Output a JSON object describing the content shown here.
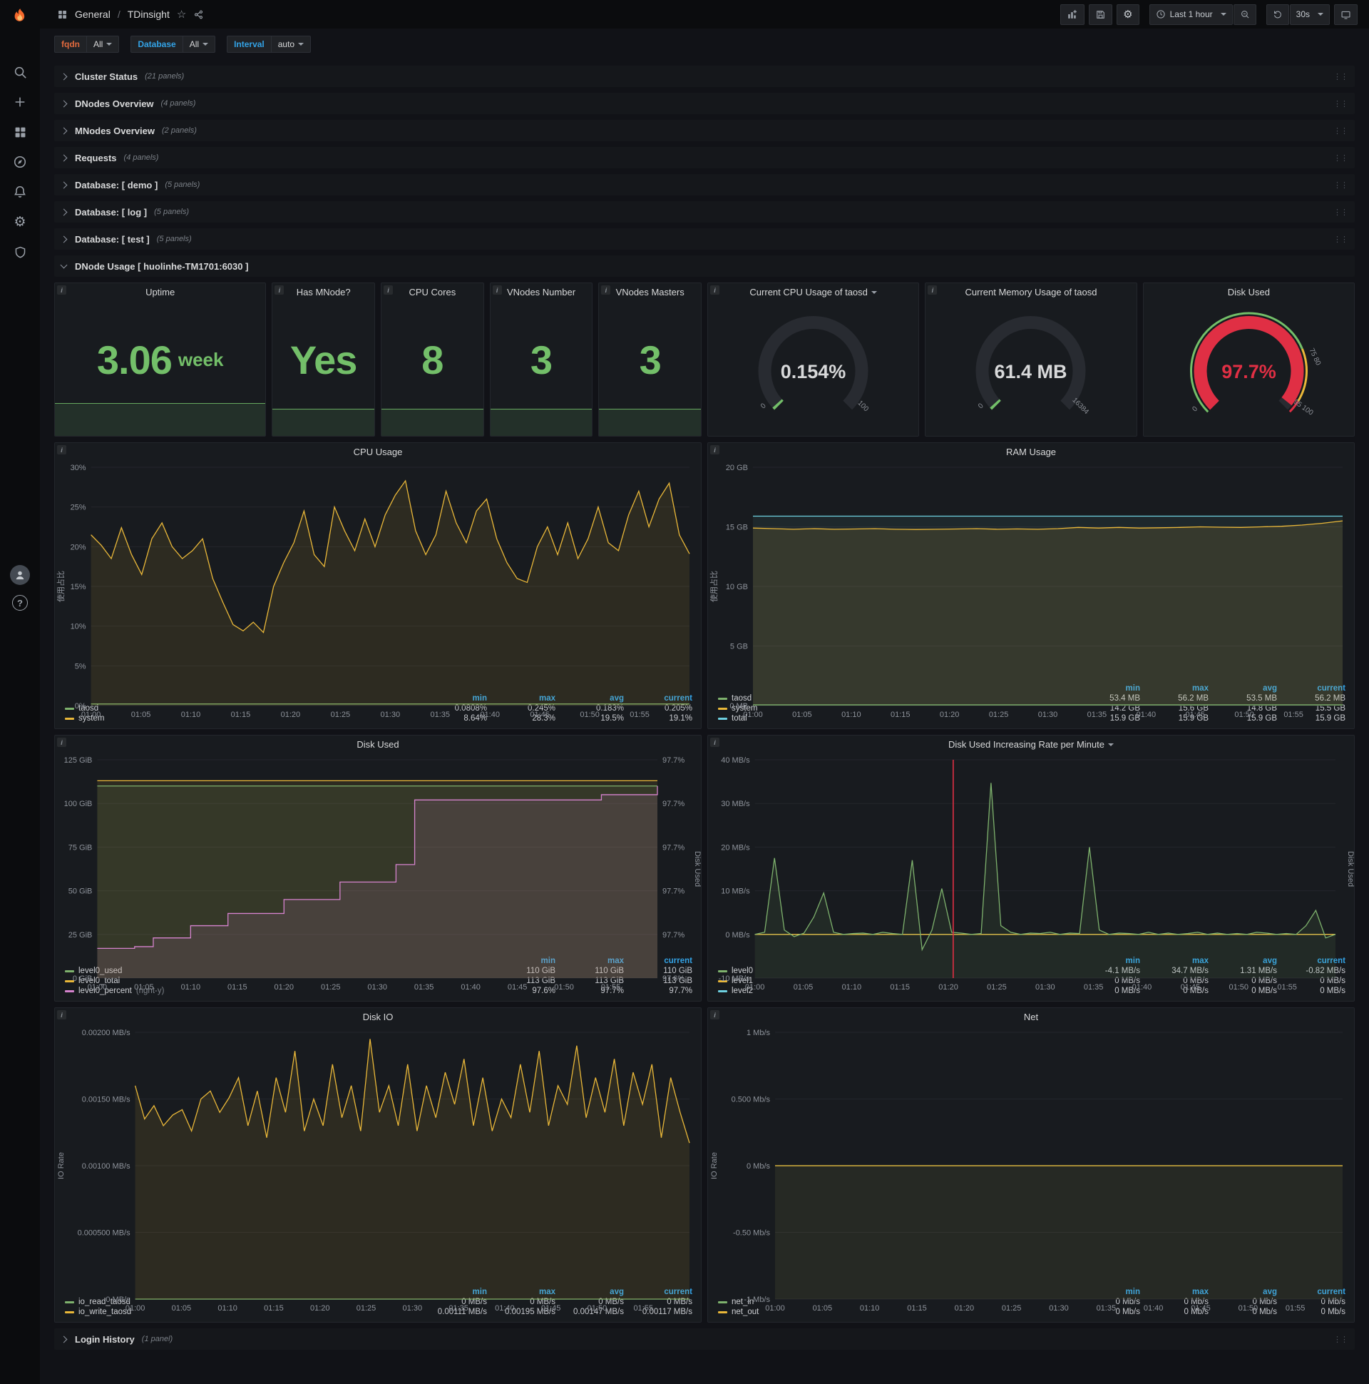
{
  "nav": {
    "breadcrumb": {
      "section": "General",
      "separator": "/",
      "title": "TDinsight"
    },
    "time_picker": {
      "label": "Last 1 hour"
    },
    "refresh": {
      "interval": "30s"
    }
  },
  "variables": [
    {
      "name": "fqdn",
      "label": "fqdn",
      "value": "All",
      "label_color": "#e0693d"
    },
    {
      "name": "database",
      "label": "Database",
      "value": "All",
      "label_color": "#33a2e5"
    },
    {
      "name": "interval",
      "label": "Interval",
      "value": "auto",
      "label_color": "#33a2e5"
    }
  ],
  "rows_top": [
    {
      "title": "Cluster Status",
      "count": "(21 panels)"
    },
    {
      "title": "DNodes Overview",
      "count": "(4 panels)"
    },
    {
      "title": "MNodes Overview",
      "count": "(2 panels)"
    },
    {
      "title": "Requests",
      "count": "(4 panels)"
    },
    {
      "title": "Database: [ demo ]",
      "count": "(5 panels)"
    },
    {
      "title": "Database: [ log ]",
      "count": "(5 panels)"
    },
    {
      "title": "Database: [ test ]",
      "count": "(5 panels)"
    }
  ],
  "expanded_row": {
    "title": "DNode Usage [ huolinhe-TM1701:6030 ]"
  },
  "rows_bottom": [
    {
      "title": "Login History",
      "count": "(1 panel)"
    }
  ],
  "stats": [
    {
      "title": "Uptime",
      "value": "3.06",
      "unit": "week",
      "color": "#73bf69"
    },
    {
      "title": "Has MNode?",
      "value": "Yes",
      "color": "#73bf69"
    },
    {
      "title": "CPU Cores",
      "value": "8",
      "color": "#73bf69"
    },
    {
      "title": "VNodes Number",
      "value": "3",
      "color": "#73bf69"
    },
    {
      "title": "VNodes Masters",
      "value": "3",
      "color": "#73bf69"
    }
  ],
  "gauges": [
    {
      "title": "Current CPU Usage of taosd",
      "menu_caret": true,
      "value": "0.154%",
      "min_label": "0",
      "max_label": "100",
      "fraction": 0.0015,
      "arc_color": "#73bf69",
      "value_color": "#d8d9da",
      "threshold_ring": false
    },
    {
      "title": "Current Memory Usage of taosd",
      "menu_caret": false,
      "value": "61.4 MB",
      "min_label": "0",
      "max_label": "16384",
      "fraction": 0.0037,
      "arc_color": "#73bf69",
      "value_color": "#d8d9da",
      "threshold_ring": false
    },
    {
      "title": "Disk Used",
      "menu_caret": false,
      "value": "97.7%",
      "min_label": "0",
      "max_label": "",
      "fraction": 0.977,
      "arc_color": "#e02f44",
      "value_color": "#e02f44",
      "threshold_ring": true,
      "ring_labels": [
        "75 80",
        "95 100"
      ]
    }
  ],
  "charts": {
    "time_axis": {
      "xlim": [
        0,
        60
      ],
      "ticks": [
        {
          "m": 0,
          "label": "01:00"
        },
        {
          "m": 5,
          "label": "01:05"
        },
        {
          "m": 10,
          "label": "01:10"
        },
        {
          "m": 15,
          "label": "01:15"
        },
        {
          "m": 20,
          "label": "01:20"
        },
        {
          "m": 25,
          "label": "01:25"
        },
        {
          "m": 30,
          "label": "01:30"
        },
        {
          "m": 35,
          "label": "01:35"
        },
        {
          "m": 40,
          "label": "01:40"
        },
        {
          "m": 45,
          "label": "01:45"
        },
        {
          "m": 50,
          "label": "01:50"
        },
        {
          "m": 55,
          "label": "01:55"
        }
      ]
    },
    "cpu": {
      "title": "CPU Usage",
      "chart_data": {
        "type": "line",
        "ylabel": "使用占比",
        "ylim": [
          0,
          30
        ],
        "y_ticks": [
          {
            "v": 0,
            "label": "0%"
          },
          {
            "v": 5,
            "label": "5%"
          },
          {
            "v": 10,
            "label": "10%"
          },
          {
            "v": 15,
            "label": "15%"
          },
          {
            "v": 20,
            "label": "20%"
          },
          {
            "v": 25,
            "label": "25%"
          },
          {
            "v": 30,
            "label": "30%"
          }
        ],
        "series": [
          {
            "name": "taosd",
            "color": "#7eb26d",
            "fill": 0.1,
            "values": [
              0.2
            ]
          },
          {
            "name": "system",
            "color": "#eab839",
            "fill": 0.1,
            "values": [
              21.5,
              20.2,
              18.5,
              22.4,
              19,
              16.5,
              21,
              23,
              20,
              18.5,
              19.5,
              21,
              16,
              13,
              10.2,
              9.4,
              10.5,
              9.2,
              15,
              18,
              20.5,
              24.5,
              19,
              17.5,
              25,
              22,
              19.5,
              23.5,
              20,
              24,
              26.5,
              28.3,
              22,
              19,
              21.5,
              27,
              23,
              20.5,
              24.5,
              26,
              21,
              18,
              16,
              15.5,
              20,
              22.5,
              19,
              23,
              18.5,
              21,
              25,
              20.5,
              19.5,
              24,
              27,
              22.5,
              26,
              28,
              21.5,
              19.1
            ]
          }
        ]
      },
      "legend": {
        "cols": [
          "min",
          "max",
          "avg",
          "current"
        ],
        "rows": [
          {
            "name": "taosd",
            "color": "#7eb26d",
            "values": [
              "0.0808%",
              "0.245%",
              "0.183%",
              "0.205%"
            ]
          },
          {
            "name": "system",
            "color": "#eab839",
            "values": [
              "8.64%",
              "28.3%",
              "19.5%",
              "19.1%"
            ]
          }
        ]
      }
    },
    "ram": {
      "title": "RAM Usage",
      "chart_data": {
        "type": "line",
        "ylabel": "使用占比",
        "ylim": [
          0,
          20
        ],
        "y_ticks": [
          {
            "v": 0,
            "label": "0 MB"
          },
          {
            "v": 5,
            "label": "5 GB"
          },
          {
            "v": 10,
            "label": "10 GB"
          },
          {
            "v": 15,
            "label": "15 GB"
          },
          {
            "v": 20,
            "label": "20 GB"
          }
        ],
        "series": [
          {
            "name": "total",
            "color": "#6ed0e0",
            "fill": 0.07,
            "values": [
              15.9
            ]
          },
          {
            "name": "system",
            "color": "#eab839",
            "fill": 0.12,
            "values": [
              14.9,
              14.85,
              14.8,
              14.85,
              14.8,
              14.82,
              14.85,
              14.8,
              14.78,
              14.8,
              14.82,
              14.85,
              14.8,
              14.83,
              14.8,
              14.85,
              14.95,
              14.9,
              14.95,
              14.9,
              14.92,
              14.95,
              15.0,
              14.97,
              14.95,
              15.0,
              15.05,
              15.15,
              15.3,
              15.5
            ]
          },
          {
            "name": "taosd",
            "color": "#7eb26d",
            "fill": 0.1,
            "values": [
              0.055
            ]
          }
        ]
      },
      "legend": {
        "cols": [
          "min",
          "max",
          "avg",
          "current"
        ],
        "rows": [
          {
            "name": "taosd",
            "color": "#7eb26d",
            "values": [
              "53.4 MB",
              "56.2 MB",
              "53.5 MB",
              "56.2 MB"
            ]
          },
          {
            "name": "system",
            "color": "#eab839",
            "values": [
              "14.2 GB",
              "15.6 GB",
              "14.8 GB",
              "15.5 GB"
            ]
          },
          {
            "name": "total",
            "color": "#6ed0e0",
            "values": [
              "15.9 GB",
              "15.9 GB",
              "15.9 GB",
              "15.9 GB"
            ]
          }
        ]
      }
    },
    "disk_used": {
      "title": "Disk Used",
      "chart_data": {
        "type": "line",
        "ylim": [
          0,
          125
        ],
        "y_ticks": [
          {
            "v": 0,
            "label": "0 GiB"
          },
          {
            "v": 25,
            "label": "25 GiB"
          },
          {
            "v": 50,
            "label": "50 GiB"
          },
          {
            "v": 75,
            "label": "75 GiB"
          },
          {
            "v": 100,
            "label": "100 GiB"
          },
          {
            "v": 125,
            "label": "125 GiB"
          }
        ],
        "right_label": "Disk Used",
        "right_ticks": {
          "labels": [
            "97.7%",
            "97.7%",
            "97.7%",
            "97.7%",
            "97.7%",
            "97.6%"
          ]
        },
        "rlim": [
          97.595,
          97.72
        ],
        "series": [
          {
            "name": "level0_total",
            "color": "#eab839",
            "fill": 0.1,
            "values": [
              113
            ]
          },
          {
            "name": "level0_used",
            "color": "#7eb26d",
            "fill": 0.1,
            "values": [
              110
            ]
          },
          {
            "name": "level0_percent",
            "color": "#d683ce",
            "fill": 0.12,
            "axis": "right",
            "step": true,
            "values": [
              97.612,
              97.612,
              97.613,
              97.618,
              97.618,
              97.625,
              97.625,
              97.632,
              97.632,
              97.632,
              97.64,
              97.64,
              97.64,
              97.65,
              97.65,
              97.65,
              97.66,
              97.697,
              97.697,
              97.697,
              97.697,
              97.697,
              97.697,
              97.697,
              97.697,
              97.697,
              97.697,
              97.7,
              97.7,
              97.7,
              97.705
            ]
          }
        ]
      },
      "legend": {
        "cols": [
          "min",
          "max",
          "current"
        ],
        "rows": [
          {
            "name": "level0_used",
            "color": "#7eb26d",
            "values": [
              "110 GiB",
              "110 GiB",
              "110 GiB"
            ]
          },
          {
            "name": "level0_total",
            "color": "#eab839",
            "values": [
              "113 GiB",
              "113 GiB",
              "113 GiB"
            ]
          },
          {
            "name": "level0_percent",
            "suffix": "(right-y)",
            "color": "#d683ce",
            "values": [
              "97.6%",
              "97.7%",
              "97.7%"
            ]
          }
        ]
      }
    },
    "disk_rate": {
      "title": "Disk Used Increasing Rate per Minute",
      "menu_caret": true,
      "chart_data": {
        "type": "line",
        "ylim": [
          -10,
          40
        ],
        "y_ticks": [
          {
            "v": -10,
            "label": "-10 MB/s"
          },
          {
            "v": 0,
            "label": "0 MB/s"
          },
          {
            "v": 10,
            "label": "10 MB/s"
          },
          {
            "v": 20,
            "label": "20 MB/s"
          },
          {
            "v": 30,
            "label": "30 MB/s"
          },
          {
            "v": 40,
            "label": "40 MB/s"
          }
        ],
        "right_label": "Disk Used",
        "annotation": {
          "x_minute": 20.5,
          "color": "#e02f44"
        },
        "series": [
          {
            "name": "level2",
            "color": "#6ed0e0",
            "fill": 0,
            "values": [
              0
            ]
          },
          {
            "name": "level1",
            "color": "#eab839",
            "fill": 0,
            "values": [
              0
            ]
          },
          {
            "name": "level0",
            "color": "#7eb26d",
            "fill": 0.1,
            "values": [
              0,
              0.5,
              17.5,
              1,
              -0.5,
              0.3,
              4,
              9.5,
              0.5,
              0,
              0.2,
              0.3,
              0,
              0.5,
              0.2,
              0,
              17,
              -3.5,
              1,
              10.5,
              0.5,
              0.3,
              0,
              0.2,
              34.7,
              2,
              0.5,
              0,
              0.3,
              0.2,
              0.5,
              0,
              0.3,
              0.2,
              20,
              1,
              0,
              0.3,
              0.2,
              0,
              0.5,
              0,
              0.3,
              0,
              0.2,
              0.5,
              0,
              0.3,
              0,
              0.2,
              0,
              0.5,
              0.3,
              0,
              0.2,
              0,
              2,
              5.5,
              -0.8,
              0
            ]
          }
        ]
      },
      "legend": {
        "cols": [
          "min",
          "max",
          "avg",
          "current"
        ],
        "rows": [
          {
            "name": "level0",
            "color": "#7eb26d",
            "values": [
              "-4.1 MB/s",
              "34.7 MB/s",
              "1.31 MB/s",
              "-0.82 MB/s"
            ]
          },
          {
            "name": "level1",
            "color": "#eab839",
            "values": [
              "0 MB/s",
              "0 MB/s",
              "0 MB/s",
              "0 MB/s"
            ]
          },
          {
            "name": "level2",
            "color": "#6ed0e0",
            "values": [
              "0 MB/s",
              "0 MB/s",
              "0 MB/s",
              "0 MB/s"
            ]
          }
        ]
      }
    },
    "disk_io": {
      "title": "Disk IO",
      "chart_data": {
        "type": "line",
        "ylabel": "IO Rate",
        "ylim": [
          0,
          0.002
        ],
        "y_ticks": [
          {
            "v": 0,
            "label": "0 MB/s"
          },
          {
            "v": 0.0005,
            "label": "0.000500 MB/s"
          },
          {
            "v": 0.001,
            "label": "0.00100 MB/s"
          },
          {
            "v": 0.0015,
            "label": "0.00150 MB/s"
          },
          {
            "v": 0.002,
            "label": "0.00200 MB/s"
          }
        ],
        "series": [
          {
            "name": "io_read_taosd",
            "color": "#7eb26d",
            "fill": 0.1,
            "values": [
              0
            ]
          },
          {
            "name": "io_write_taosd",
            "color": "#eab839",
            "fill": 0.1,
            "values": [
              0.0016,
              0.00135,
              0.00145,
              0.0013,
              0.00138,
              0.00142,
              0.00126,
              0.0015,
              0.00156,
              0.0014,
              0.00151,
              0.00166,
              0.0013,
              0.00156,
              0.00121,
              0.00166,
              0.0014,
              0.00186,
              0.00126,
              0.0015,
              0.0013,
              0.00176,
              0.00136,
              0.0016,
              0.00126,
              0.00195,
              0.0014,
              0.0016,
              0.0013,
              0.00176,
              0.00126,
              0.0016,
              0.00136,
              0.0017,
              0.00146,
              0.0018,
              0.0013,
              0.00166,
              0.00126,
              0.0015,
              0.00136,
              0.00176,
              0.0014,
              0.00186,
              0.0013,
              0.0016,
              0.00146,
              0.0019,
              0.00136,
              0.00166,
              0.0014,
              0.0018,
              0.0013,
              0.0017,
              0.00146,
              0.00176,
              0.00121,
              0.00166,
              0.0014,
              0.00117
            ]
          }
        ]
      },
      "legend": {
        "cols": [
          "min",
          "max",
          "avg",
          "current"
        ],
        "rows": [
          {
            "name": "io_read_taosd",
            "color": "#7eb26d",
            "values": [
              "0 MB/s",
              "0 MB/s",
              "0 MB/s",
              "0 MB/s"
            ]
          },
          {
            "name": "io_write_taosd",
            "color": "#eab839",
            "values": [
              "0.00111 MB/s",
              "0.00195 MB/s",
              "0.00147 MB/s",
              "0.00117 MB/s"
            ]
          }
        ]
      }
    },
    "net": {
      "title": "Net",
      "chart_data": {
        "type": "line",
        "ylabel": "IO Rate",
        "ylim": [
          -1,
          1
        ],
        "y_ticks": [
          {
            "v": -1,
            "label": "-1 Mb/s"
          },
          {
            "v": -0.5,
            "label": "-0.50 Mb/s"
          },
          {
            "v": 0,
            "label": "0 Mb/s"
          },
          {
            "v": 0.5,
            "label": "0.500 Mb/s"
          },
          {
            "v": 1,
            "label": "1 Mb/s"
          }
        ],
        "series": [
          {
            "name": "net_in",
            "color": "#7eb26d",
            "fill": 0.05,
            "values": [
              0
            ]
          },
          {
            "name": "net_out",
            "color": "#eab839",
            "fill": 0.05,
            "values": [
              0
            ]
          }
        ]
      },
      "legend": {
        "cols": [
          "min",
          "max",
          "avg",
          "current"
        ],
        "rows": [
          {
            "name": "net_in",
            "color": "#7eb26d",
            "values": [
              "0 Mb/s",
              "0 Mb/s",
              "0 Mb/s",
              "0 Mb/s"
            ]
          },
          {
            "name": "net_out",
            "color": "#eab839",
            "values": [
              "0 Mb/s",
              "0 Mb/s",
              "0 Mb/s",
              "0 Mb/s"
            ]
          }
        ]
      }
    }
  }
}
